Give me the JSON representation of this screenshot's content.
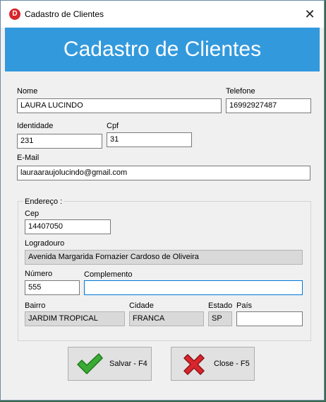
{
  "window": {
    "title": "Cadastro de Clientes",
    "app_icon_letter": "D"
  },
  "banner": {
    "title": "Cadastro de Clientes"
  },
  "fields": {
    "nome": {
      "label": "Nome",
      "value": "LAURA LUCINDO"
    },
    "telefone": {
      "label": "Telefone",
      "value": "16992927487"
    },
    "identidade": {
      "label": "Identidade",
      "value": "231"
    },
    "cpf": {
      "label": "Cpf",
      "value": "31"
    },
    "email": {
      "label": "E-Mail",
      "value": "lauraaraujolucindo@gmail.com"
    }
  },
  "endereco": {
    "group_label": "Endereço :",
    "cep": {
      "label": "Cep",
      "value": "14407050"
    },
    "logradouro": {
      "label": "Logradouro",
      "value": "Avenida Margarida Fornazier Cardoso de Oliveira"
    },
    "numero": {
      "label": "Número",
      "value": "555"
    },
    "complemento": {
      "label": "Complemento",
      "value": ""
    },
    "bairro": {
      "label": "Bairro",
      "value": "JARDIM TROPICAL"
    },
    "cidade": {
      "label": "Cidade",
      "value": "FRANCA"
    },
    "estado": {
      "label": "Estado",
      "value": "SP"
    },
    "pais": {
      "label": "País",
      "value": ""
    }
  },
  "buttons": {
    "save": {
      "label": "Salvar - F4",
      "icon": "checkmark-icon",
      "color": "#3aaa35"
    },
    "close": {
      "label": "Close - F5",
      "icon": "red-x-icon",
      "color": "#d9262c"
    }
  },
  "colors": {
    "banner": "#3399dd",
    "focus_border": "#0078d7"
  }
}
